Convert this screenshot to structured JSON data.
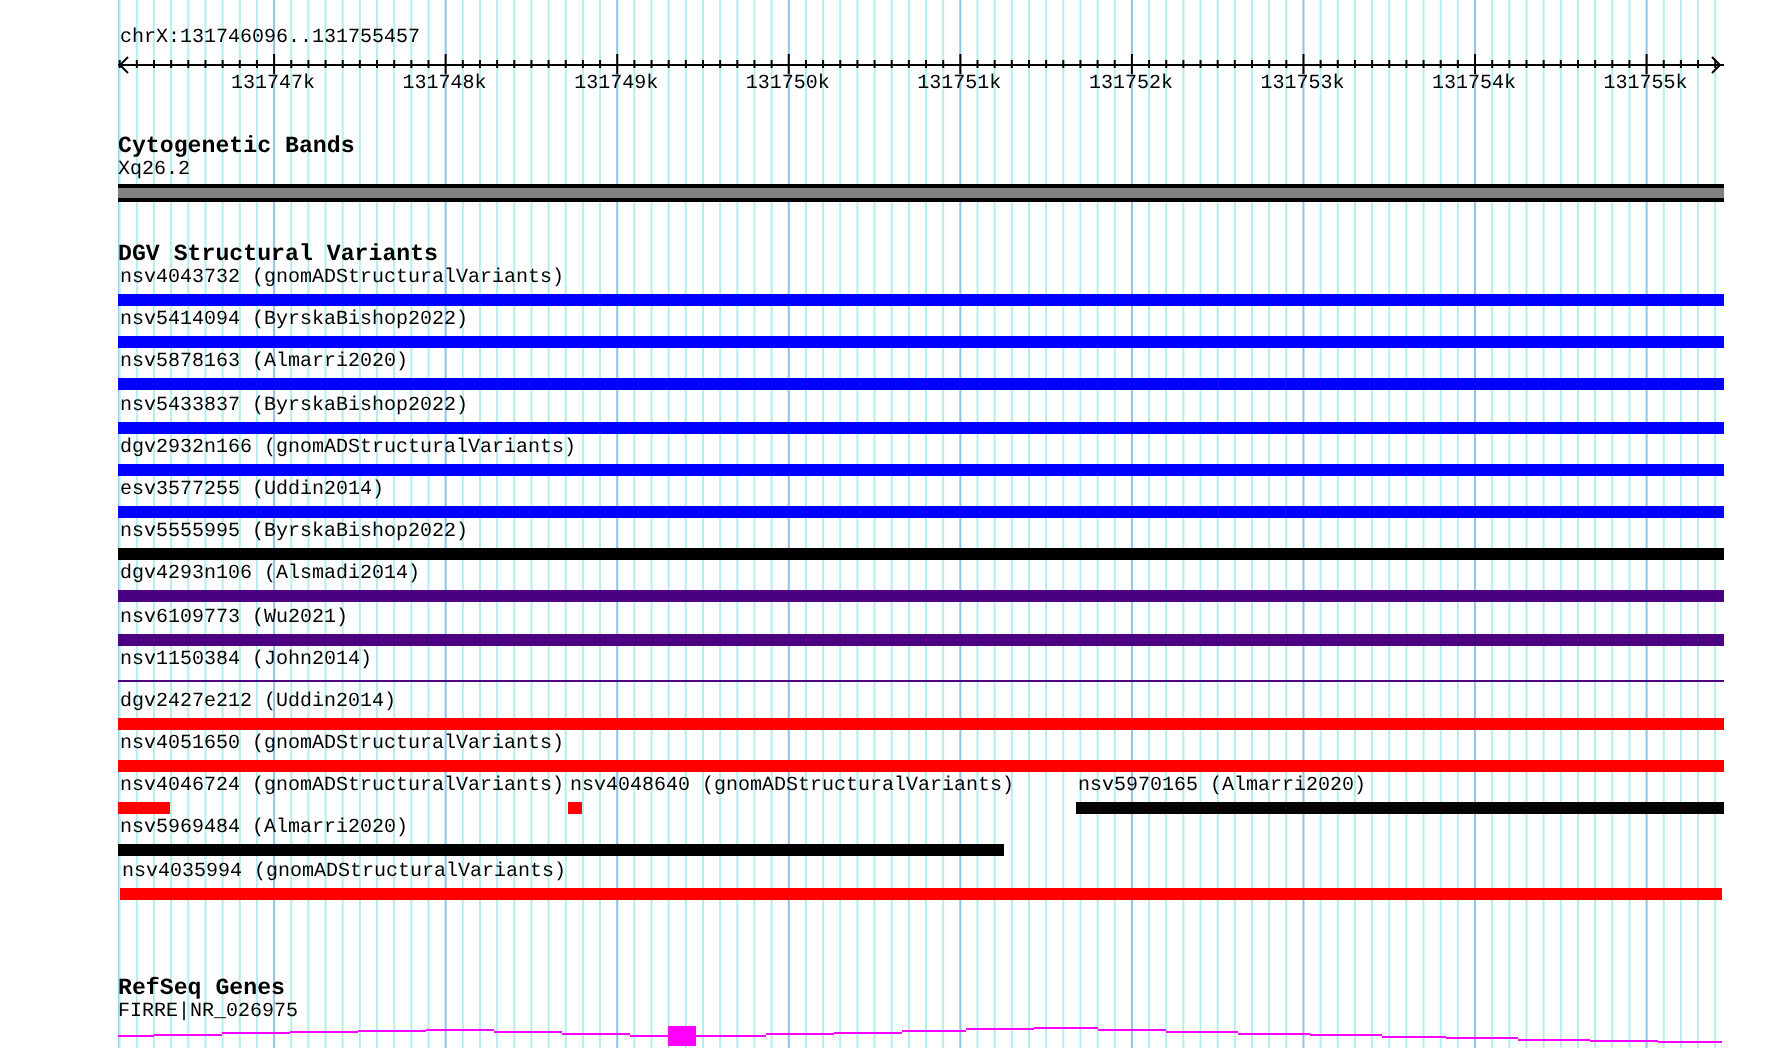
{
  "location": "chrX:131746096..131755457",
  "ruler": {
    "tick_labels": [
      "131747k",
      "131748k",
      "131749k",
      "131750k",
      "131751k",
      "131752k",
      "131753k",
      "131754k",
      "131755k"
    ]
  },
  "tracks": [
    {
      "title": "Cytogenetic Bands",
      "kind": "cytoband",
      "features": [
        {
          "label": "Xq26.2"
        }
      ]
    },
    {
      "title": "DGV Structural Variants",
      "kind": "variants",
      "rows": [
        {
          "features": [
            {
              "label": "nsv4043732 (gnomADStructuralVariants)",
              "color": "#0000ff",
              "kind": "bar"
            }
          ]
        },
        {
          "features": [
            {
              "label": "nsv5414094 (ByrskaBishop2022)",
              "color": "#0000ff",
              "kind": "bar"
            }
          ]
        },
        {
          "features": [
            {
              "label": "nsv5878163 (Almarri2020)",
              "color": "#0000ff",
              "kind": "bar"
            }
          ]
        },
        {
          "features": [
            {
              "label": "nsv5433837 (ByrskaBishop2022)",
              "color": "#0000ff",
              "kind": "bar"
            }
          ]
        },
        {
          "features": [
            {
              "label": "dgv2932n166 (gnomADStructuralVariants)",
              "color": "#0000ff",
              "kind": "bar"
            }
          ]
        },
        {
          "features": [
            {
              "label": "esv3577255 (Uddin2014)",
              "color": "#0000ff",
              "kind": "bar"
            }
          ]
        },
        {
          "features": [
            {
              "label": "nsv5555995 (ByrskaBishop2022)",
              "color": "#000000",
              "kind": "bar"
            }
          ]
        },
        {
          "features": [
            {
              "label": "dgv4293n106 (Alsmadi2014)",
              "color": "#4b0082",
              "kind": "bar"
            }
          ]
        },
        {
          "features": [
            {
              "label": "nsv6109773 (Wu2021)",
              "color": "#4b0082",
              "kind": "bar"
            }
          ]
        },
        {
          "features": [
            {
              "label": "nsv1150384 (John2014)",
              "color": "#4b0082",
              "kind": "line"
            }
          ]
        },
        {
          "features": [
            {
              "label": "dgv2427e212 (Uddin2014)",
              "color": "#ff0000",
              "kind": "bar"
            }
          ]
        },
        {
          "features": [
            {
              "label": "nsv4051650 (gnomADStructuralVariants)",
              "color": "#ff0000",
              "kind": "bar"
            }
          ]
        },
        {
          "features": [
            {
              "label": "nsv4046724 (gnomADStructuralVariants)",
              "color": "#ff0000",
              "kind": "bar"
            },
            {
              "label": "nsv4048640 (gnomADStructuralVariants)",
              "color": "#ff0000",
              "kind": "bar"
            },
            {
              "label": "nsv5970165 (Almarri2020)",
              "color": "#000000",
              "kind": "bar"
            }
          ]
        },
        {
          "features": [
            {
              "label": "nsv5969484 (Almarri2020)",
              "color": "#000000",
              "kind": "bar"
            }
          ]
        },
        {
          "features": [
            {
              "label": "nsv4035994 (gnomADStructuralVariants)",
              "color": "#ff0000",
              "kind": "bar"
            }
          ]
        }
      ]
    },
    {
      "title": "RefSeq Genes",
      "kind": "genes",
      "features": [
        {
          "label": "FIRRE|NR_026975"
        }
      ]
    }
  ]
}
